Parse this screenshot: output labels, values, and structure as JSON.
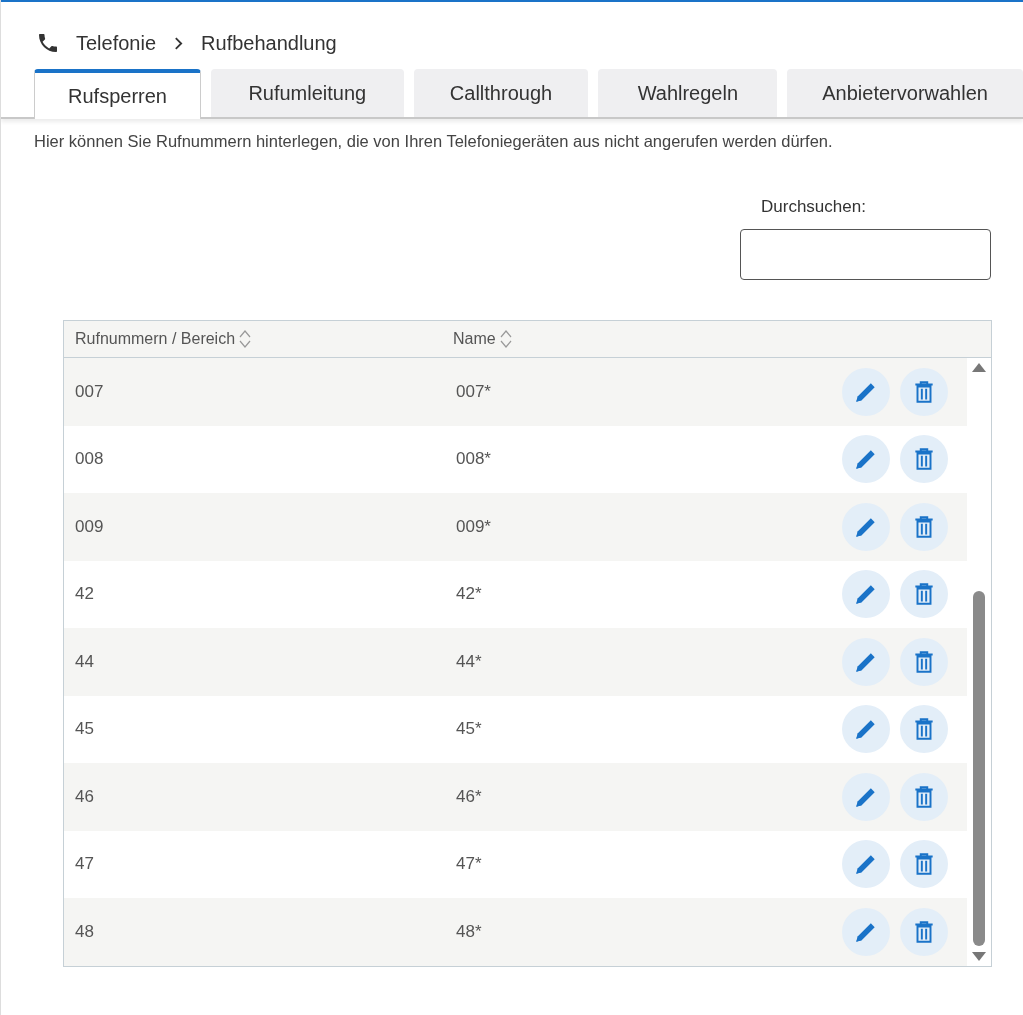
{
  "breadcrumb": [
    "Telefonie",
    "Rufbehandlung"
  ],
  "tabs": [
    {
      "label": "Rufsperren",
      "selected": true
    },
    {
      "label": "Rufumleitung",
      "selected": false
    },
    {
      "label": "Callthrough",
      "selected": false
    },
    {
      "label": "Wahlregeln",
      "selected": false
    },
    {
      "label": "Anbietervorwahlen",
      "selected": false
    }
  ],
  "description": "Hier können Sie Rufnummern hinterlegen, die von Ihren Telefoniegeräten aus nicht angerufen werden dürfen.",
  "search": {
    "label": "Durchsuchen:"
  },
  "table": {
    "columns": [
      "Rufnummern / Bereich",
      "Name"
    ],
    "rows": [
      [
        "007",
        "007*"
      ],
      [
        "008",
        "008*"
      ],
      [
        "009",
        "009*"
      ],
      [
        "42",
        "42*"
      ],
      [
        "44",
        "44*"
      ],
      [
        "45",
        "45*"
      ],
      [
        "46",
        "46*"
      ],
      [
        "47",
        "47*"
      ],
      [
        "48",
        "48*"
      ]
    ]
  }
}
